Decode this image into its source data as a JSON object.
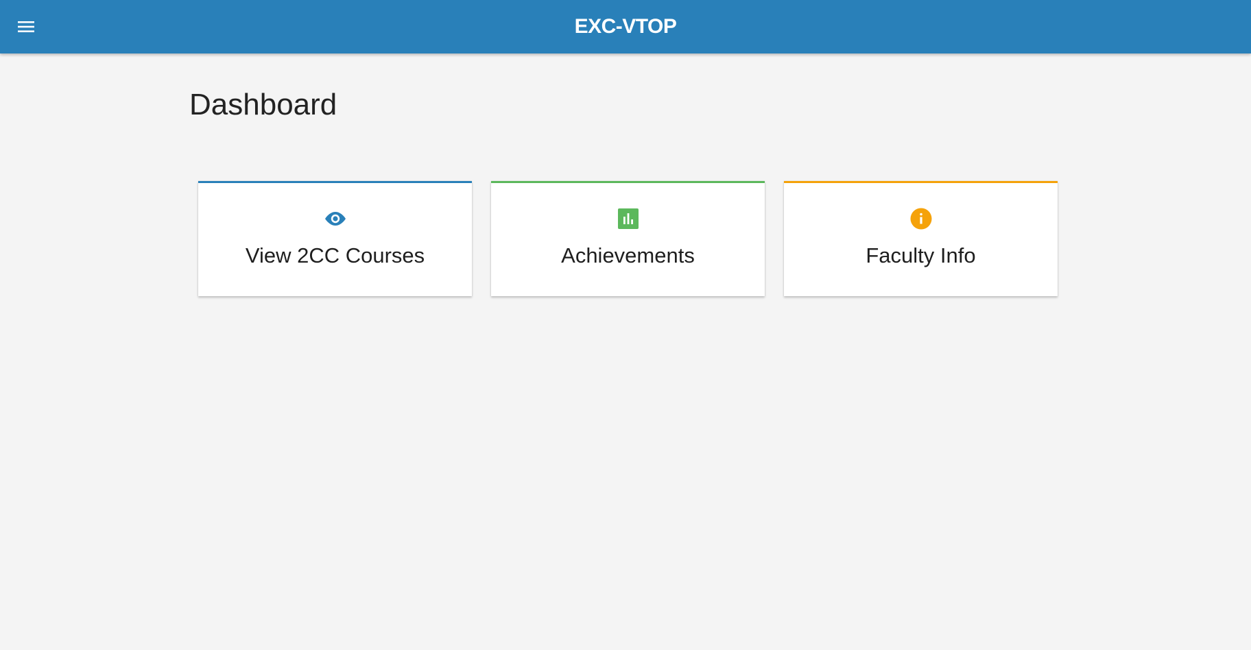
{
  "header": {
    "title": "EXC-VTOP",
    "menu_icon": "hamburger-menu-icon",
    "background": "#2980b9"
  },
  "main": {
    "title": "Dashboard",
    "cards": [
      {
        "label": "View 2CC Courses",
        "icon": "eye-icon",
        "accent": "#2980b9"
      },
      {
        "label": "Achievements",
        "icon": "bar-chart-icon",
        "accent": "#5cb85c"
      },
      {
        "label": "Faculty Info",
        "icon": "info-icon",
        "accent": "#f5a20a"
      }
    ]
  }
}
